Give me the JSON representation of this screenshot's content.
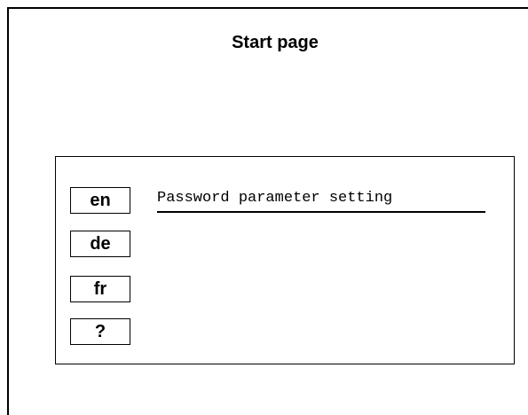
{
  "page": {
    "title": "Start page"
  },
  "languages": [
    {
      "code": "en"
    },
    {
      "code": "de"
    },
    {
      "code": "fr"
    },
    {
      "code": "?"
    }
  ],
  "links": {
    "password_parameter_setting": "Password parameter setting"
  }
}
